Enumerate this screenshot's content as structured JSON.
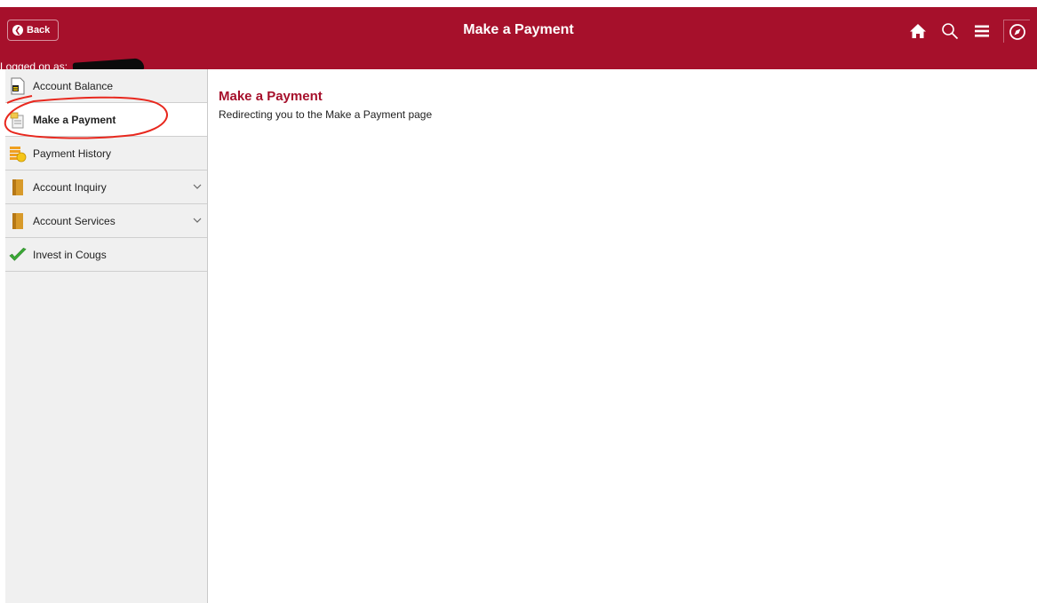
{
  "header": {
    "back_label": "Back",
    "title": "Make a Payment",
    "logged_on_label": "Logged on as:",
    "icons": [
      "home-icon",
      "search-icon",
      "menu-icon",
      "navbar-icon"
    ]
  },
  "sidebar": {
    "items": [
      {
        "label": "Account Balance",
        "icon": "account-balance-icon"
      },
      {
        "label": "Make a Payment",
        "icon": "payment-icon",
        "active": true
      },
      {
        "label": "Payment History",
        "icon": "payment-history-icon"
      },
      {
        "label": "Account Inquiry",
        "icon": "folder-icon",
        "expandable": true
      },
      {
        "label": "Account Services",
        "icon": "folder-icon",
        "expandable": true
      },
      {
        "label": "Invest in Cougs",
        "icon": "checkmark-icon"
      }
    ]
  },
  "main": {
    "title": "Make a Payment",
    "message": "Redirecting you to the Make a Payment page"
  },
  "colors": {
    "brand": "#a6102b",
    "sidebar_bg": "#f0f0f0",
    "annotation": "#e8281e"
  }
}
